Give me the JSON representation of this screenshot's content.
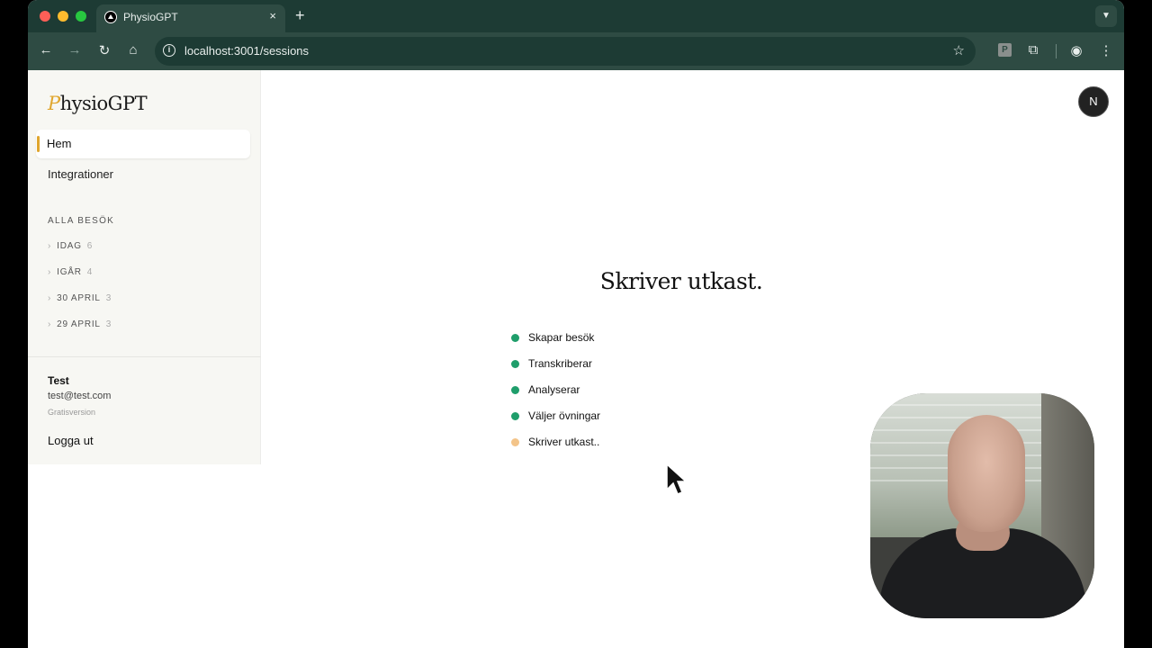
{
  "browser": {
    "tab_title": "PhysioGPT",
    "tab_close": "×",
    "new_tab": "+",
    "url": "localhost:3001/sessions",
    "icons": [
      "back-icon",
      "forward-icon",
      "reload-icon",
      "home-icon",
      "info-icon",
      "star-icon",
      "extension-icon",
      "profile-icon",
      "menu-icon"
    ]
  },
  "sidebar": {
    "logo_p": "P",
    "logo_rest": "hysioGPT",
    "nav": [
      {
        "label": "Hem"
      },
      {
        "label": "Integrationer"
      }
    ],
    "section_title": "ALLA BESÖK",
    "groups": [
      {
        "label": "IDAG",
        "count": "6"
      },
      {
        "label": "IGÅR",
        "count": "4"
      },
      {
        "label": "30 APRIL",
        "count": "3"
      },
      {
        "label": "29 APRIL",
        "count": "3"
      }
    ],
    "user": {
      "name": "Test",
      "email": "test@test.com",
      "plan": "Gratisversion"
    },
    "logout": "Logga ut"
  },
  "main": {
    "avatar_letter": "N",
    "heading": "Skriver utkast.",
    "steps": [
      {
        "label": "Skapar besök",
        "status": "done"
      },
      {
        "label": "Transkriberar",
        "status": "done"
      },
      {
        "label": "Analyserar",
        "status": "done"
      },
      {
        "label": "Väljer övningar",
        "status": "done"
      },
      {
        "label": "Skriver utkast..",
        "status": "in-progress"
      }
    ]
  },
  "colors": {
    "accent": "#e0a62e",
    "done": "#1f9e6b",
    "in_progress": "#f3c489",
    "browser_frame": "#1d3b34"
  }
}
